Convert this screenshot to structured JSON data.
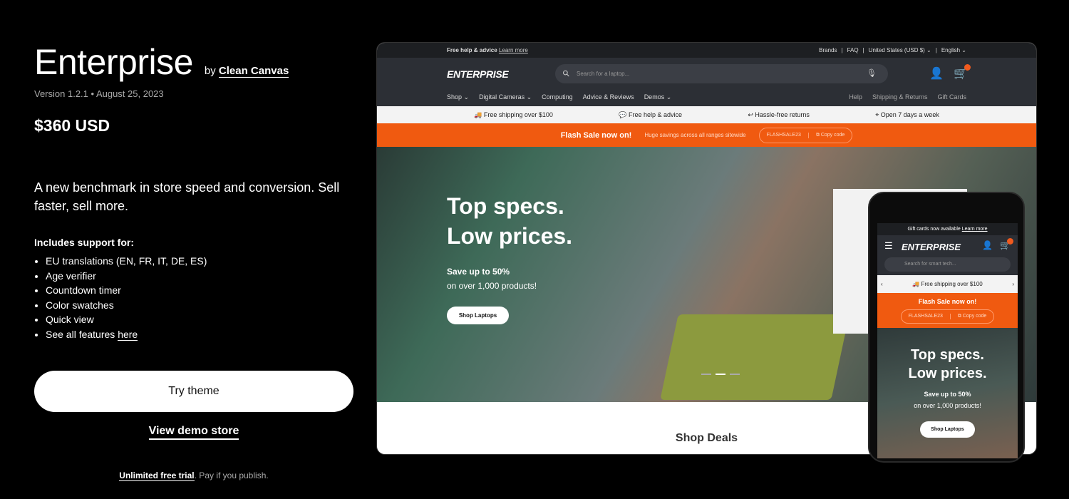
{
  "theme": {
    "title": "Enterprise",
    "by": "by",
    "author": "Clean Canvas",
    "version": "Version 1.2.1 • August 25, 2023",
    "price": "$360 USD",
    "tagline": "A new benchmark in store speed and conversion. Sell faster, sell more.",
    "includes_heading": "Includes support for:",
    "features": [
      "EU translations (EN, FR, IT, DE, ES)",
      "Age verifier",
      "Countdown timer",
      "Color swatches",
      "Quick view"
    ],
    "see_all_prefix": "See all features",
    "see_all_link": "here",
    "try_label": "Try theme",
    "demo_label": "View demo store",
    "trial_link": "Unlimited free trial",
    "trial_rest": ". Pay if you publish."
  },
  "desktop": {
    "announcement": "Free help & advice",
    "learn_more": "Learn more",
    "top_links": [
      "Brands",
      "|",
      "FAQ",
      "|",
      "United States (USD $) ⌄",
      "|",
      "English ⌄"
    ],
    "logo": "ENTERPRISE",
    "search_placeholder": "Search for a laptop...",
    "nav": [
      "Shop ⌄",
      "Digital Cameras ⌄",
      "Computing",
      "Advice & Reviews",
      "Demos ⌄"
    ],
    "nav_right": [
      "Help",
      "Shipping & Returns",
      "Gift Cards"
    ],
    "usps": [
      "🚚 Free shipping over $100",
      "💬 Free help & advice",
      "↩ Hassle-free returns",
      "⌖ Open 7 days a week"
    ],
    "flash_title": "Flash Sale now on!",
    "flash_sub": "Huge savings across all ranges sitewide",
    "code": "FLASHSALE23",
    "copy": "⧉ Copy code",
    "hero_line1": "Top specs.",
    "hero_line2": "Low prices.",
    "hero_save": "Save up to 50%",
    "hero_sub": "on over 1,000 products!",
    "hero_button": "Shop Laptops",
    "section": "Shop Deals",
    "accent": "#f05a10"
  },
  "mobile": {
    "announcement": "Gift cards now available",
    "learn_more": "Learn more",
    "logo": "ENTERPRISE",
    "search_placeholder": "Search for smart tech...",
    "usp": "🚚 Free shipping over $100",
    "flash_title": "Flash Sale now on!",
    "code": "FLASHSALE23",
    "copy": "⧉ Copy code",
    "hero_line1": "Top specs.",
    "hero_line2": "Low prices.",
    "hero_save": "Save up to 50%",
    "hero_sub": "on over 1,000 products!",
    "hero_button": "Shop Laptops"
  }
}
